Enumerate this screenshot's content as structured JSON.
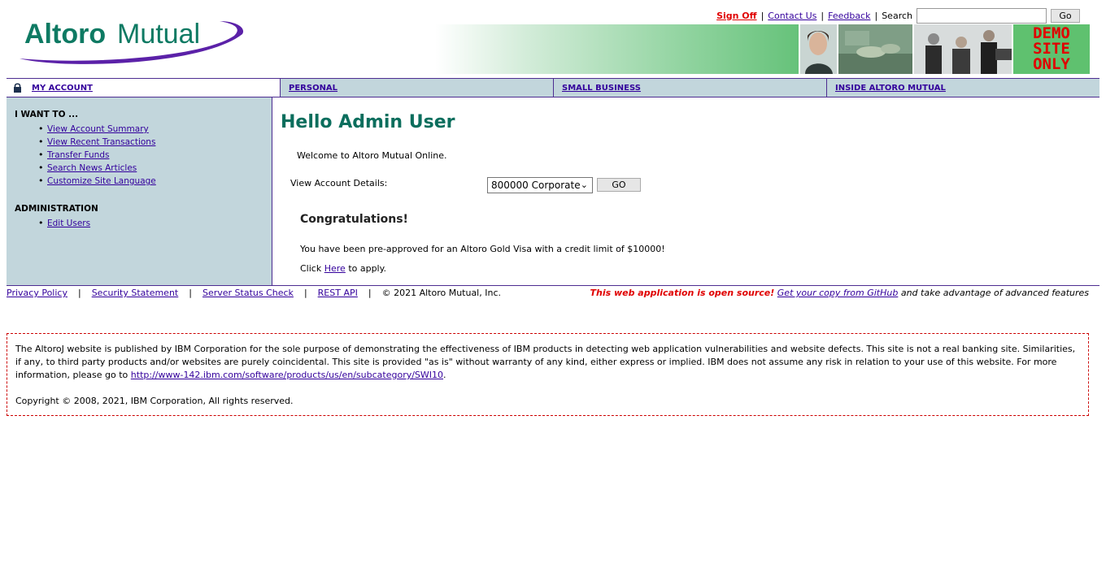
{
  "header": {
    "logo_text": "AltoroMutual",
    "links": {
      "sign_off": "Sign Off",
      "contact_us": "Contact Us",
      "feedback": "Feedback"
    },
    "search_label": "Search",
    "search_value": "",
    "search_button": "Go",
    "demo_lines": [
      "DEMO",
      "SITE",
      "ONLY"
    ]
  },
  "nav": {
    "tabs": [
      {
        "label": "MY ACCOUNT"
      },
      {
        "label": "PERSONAL"
      },
      {
        "label": "SMALL BUSINESS"
      },
      {
        "label": "INSIDE ALTORO MUTUAL"
      }
    ]
  },
  "sidebar": {
    "i_want_heading": "I WANT TO ...",
    "i_want_items": [
      "View Account Summary",
      "View Recent Transactions",
      "Transfer Funds",
      "Search News Articles",
      "Customize Site Language"
    ],
    "admin_heading": "ADMINISTRATION",
    "admin_items": [
      "Edit Users"
    ]
  },
  "main": {
    "greeting": "Hello Admin User",
    "welcome": "Welcome to Altoro Mutual Online.",
    "view_account_label": "View Account Details:",
    "selected_account": "800000 Corporate",
    "go_button": "GO",
    "congrats_title": "Congratulations!",
    "preapproved_text": "You have been pre-approved for an Altoro Gold Visa with a credit limit of $10000!",
    "click_prefix": "Click",
    "click_link": "Here",
    "click_suffix": "to apply."
  },
  "footer": {
    "links": [
      "Privacy Policy",
      "Security Statement",
      "Server Status Check",
      "REST API"
    ],
    "copyright": "© 2021 Altoro Mutual, Inc.",
    "open_source_red": "This web application is open source!",
    "open_source_link": "Get your copy from GitHub",
    "open_source_rest": "and take advantage of advanced features"
  },
  "disclaimer": {
    "text": "The AltoroJ website is published by IBM Corporation for the sole purpose of demonstrating the effectiveness of IBM products in detecting web application vulnerabilities and website defects. This site is not a real banking site. Similarities, if any, to third party products and/or websites are purely coincidental. This site is provided \"as is\" without warranty of any kind, either express or implied. IBM does not assume any risk in relation to your use of this website. For more information, please go to",
    "link": "http://www-142.ibm.com/software/products/us/en/subcategory/SWI10",
    "link_suffix": ".",
    "copyright": "Copyright © 2008, 2021, IBM Corporation, All rights reserved."
  },
  "colors": {
    "brand_green": "#0b6e5d",
    "brand_purple": "#4d2d91",
    "sidebar_bg": "#c2d6dc",
    "alert_red": "#e00000"
  }
}
